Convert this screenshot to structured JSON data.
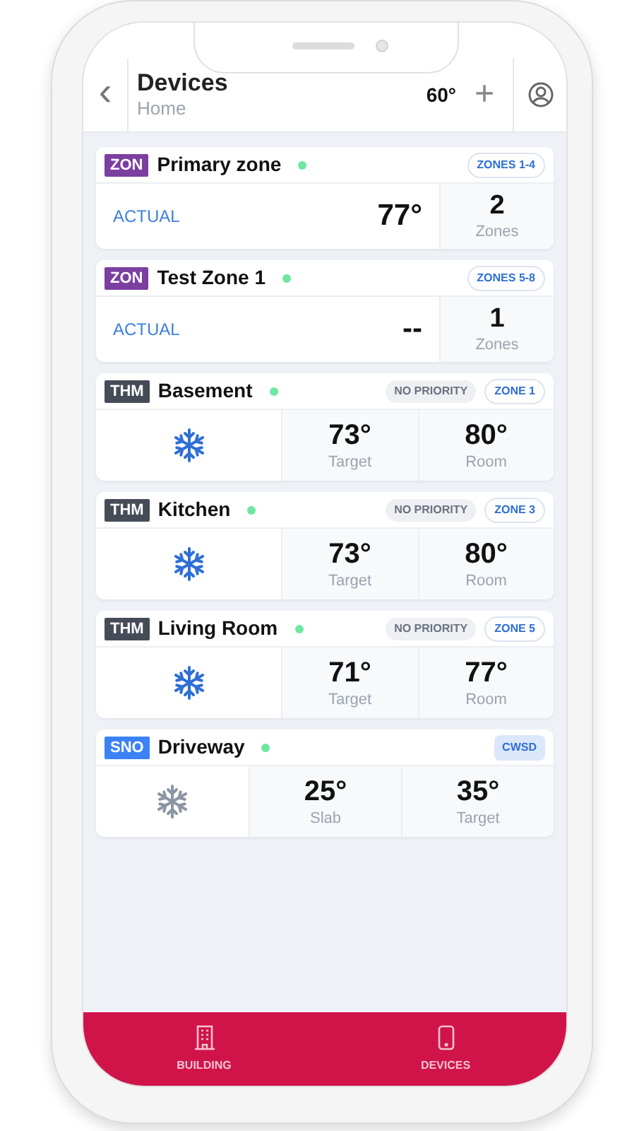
{
  "header": {
    "back": "‹",
    "title": "Devices",
    "subtitle": "Home",
    "temperature": "60°",
    "add": "+"
  },
  "devices": [
    {
      "kind": "zone",
      "tag": "ZON",
      "color": "#7b3fa0",
      "name": "Primary zone",
      "online": true,
      "badges": [
        {
          "label": "ZONES 1-4",
          "kind": "outline"
        }
      ],
      "label": "ACTUAL",
      "value": "77°",
      "count": "2",
      "count_label": "Zones"
    },
    {
      "kind": "zone",
      "tag": "ZON",
      "color": "#7b3fa0",
      "name": "Test Zone 1",
      "online": true,
      "badges": [
        {
          "label": "ZONES 5-8",
          "kind": "outline"
        }
      ],
      "label": "ACTUAL",
      "value": "--",
      "count": "1",
      "count_label": "Zones"
    },
    {
      "kind": "thermostat",
      "tag": "THM",
      "color": "#454c57",
      "name": "Basement",
      "online": true,
      "icon_active": true,
      "badges": [
        {
          "label": "NO PRIORITY",
          "kind": "gray"
        },
        {
          "label": "ZONE 1",
          "kind": "outline"
        }
      ],
      "readings": [
        {
          "value": "73°",
          "label": "Target"
        },
        {
          "value": "80°",
          "label": "Room"
        }
      ]
    },
    {
      "kind": "thermostat",
      "tag": "THM",
      "color": "#454c57",
      "name": "Kitchen",
      "online": true,
      "icon_active": true,
      "badges": [
        {
          "label": "NO PRIORITY",
          "kind": "gray"
        },
        {
          "label": "ZONE 3",
          "kind": "outline"
        }
      ],
      "readings": [
        {
          "value": "73°",
          "label": "Target"
        },
        {
          "value": "80°",
          "label": "Room"
        }
      ]
    },
    {
      "kind": "thermostat",
      "tag": "THM",
      "color": "#454c57",
      "name": "Living Room",
      "online": true,
      "icon_active": true,
      "badges": [
        {
          "label": "NO PRIORITY",
          "kind": "gray"
        },
        {
          "label": "ZONE 5",
          "kind": "outline"
        }
      ],
      "readings": [
        {
          "value": "71°",
          "label": "Target"
        },
        {
          "value": "77°",
          "label": "Room"
        }
      ]
    },
    {
      "kind": "snowmelt",
      "tag": "SNO",
      "color": "#3b82f6",
      "name": "Driveway",
      "online": true,
      "icon_active": false,
      "badges": [
        {
          "label": "CWSD",
          "kind": "filled"
        }
      ],
      "readings": [
        {
          "value": "25°",
          "label": "Slab"
        },
        {
          "value": "35°",
          "label": "Target"
        }
      ]
    }
  ],
  "nav": [
    {
      "kind": "building",
      "label": "BUILDING"
    },
    {
      "kind": "device",
      "label": "DEVICES"
    }
  ]
}
